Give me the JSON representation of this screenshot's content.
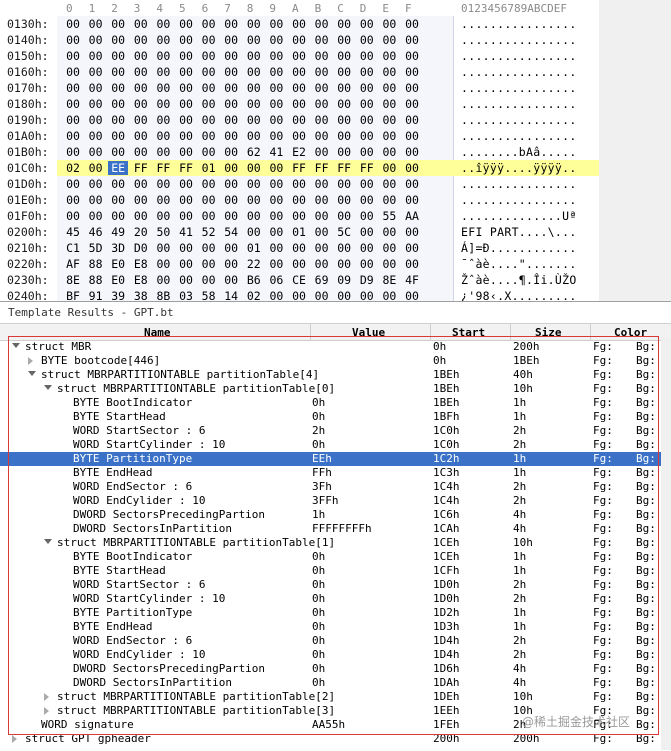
{
  "hex": {
    "column_headers": [
      "0",
      "1",
      "2",
      "3",
      "4",
      "5",
      "6",
      "7",
      "8",
      "9",
      "A",
      "B",
      "C",
      "D",
      "E",
      "F"
    ],
    "ascii_header": "0123456789ABCDEF",
    "rows": [
      {
        "offset": "0130h:",
        "bytes": [
          "00",
          "00",
          "00",
          "00",
          "00",
          "00",
          "00",
          "00",
          "00",
          "00",
          "00",
          "00",
          "00",
          "00",
          "00",
          "00"
        ],
        "ascii": "................"
      },
      {
        "offset": "0140h:",
        "bytes": [
          "00",
          "00",
          "00",
          "00",
          "00",
          "00",
          "00",
          "00",
          "00",
          "00",
          "00",
          "00",
          "00",
          "00",
          "00",
          "00"
        ],
        "ascii": "................"
      },
      {
        "offset": "0150h:",
        "bytes": [
          "00",
          "00",
          "00",
          "00",
          "00",
          "00",
          "00",
          "00",
          "00",
          "00",
          "00",
          "00",
          "00",
          "00",
          "00",
          "00"
        ],
        "ascii": "................"
      },
      {
        "offset": "0160h:",
        "bytes": [
          "00",
          "00",
          "00",
          "00",
          "00",
          "00",
          "00",
          "00",
          "00",
          "00",
          "00",
          "00",
          "00",
          "00",
          "00",
          "00"
        ],
        "ascii": "................"
      },
      {
        "offset": "0170h:",
        "bytes": [
          "00",
          "00",
          "00",
          "00",
          "00",
          "00",
          "00",
          "00",
          "00",
          "00",
          "00",
          "00",
          "00",
          "00",
          "00",
          "00"
        ],
        "ascii": "................"
      },
      {
        "offset": "0180h:",
        "bytes": [
          "00",
          "00",
          "00",
          "00",
          "00",
          "00",
          "00",
          "00",
          "00",
          "00",
          "00",
          "00",
          "00",
          "00",
          "00",
          "00"
        ],
        "ascii": "................"
      },
      {
        "offset": "0190h:",
        "bytes": [
          "00",
          "00",
          "00",
          "00",
          "00",
          "00",
          "00",
          "00",
          "00",
          "00",
          "00",
          "00",
          "00",
          "00",
          "00",
          "00"
        ],
        "ascii": "................"
      },
      {
        "offset": "01A0h:",
        "bytes": [
          "00",
          "00",
          "00",
          "00",
          "00",
          "00",
          "00",
          "00",
          "00",
          "00",
          "00",
          "00",
          "00",
          "00",
          "00",
          "00"
        ],
        "ascii": "................"
      },
      {
        "offset": "01B0h:",
        "bytes": [
          "00",
          "00",
          "00",
          "00",
          "00",
          "00",
          "00",
          "00",
          "62",
          "41",
          "E2",
          "00",
          "00",
          "00",
          "00",
          "00"
        ],
        "ascii": "........bAâ....."
      },
      {
        "offset": "01C0h:",
        "bytes": [
          "02",
          "00",
          "EE",
          "FF",
          "FF",
          "FF",
          "01",
          "00",
          "00",
          "00",
          "FF",
          "FF",
          "FF",
          "FF",
          "00",
          "00"
        ],
        "ascii": "..îÿÿÿ....ÿÿÿÿ..",
        "highlight": true,
        "selected_index": 2
      },
      {
        "offset": "01D0h:",
        "bytes": [
          "00",
          "00",
          "00",
          "00",
          "00",
          "00",
          "00",
          "00",
          "00",
          "00",
          "00",
          "00",
          "00",
          "00",
          "00",
          "00"
        ],
        "ascii": "................"
      },
      {
        "offset": "01E0h:",
        "bytes": [
          "00",
          "00",
          "00",
          "00",
          "00",
          "00",
          "00",
          "00",
          "00",
          "00",
          "00",
          "00",
          "00",
          "00",
          "00",
          "00"
        ],
        "ascii": "................"
      },
      {
        "offset": "01F0h:",
        "bytes": [
          "00",
          "00",
          "00",
          "00",
          "00",
          "00",
          "00",
          "00",
          "00",
          "00",
          "00",
          "00",
          "00",
          "00",
          "55",
          "AA"
        ],
        "ascii": "..............Uª"
      },
      {
        "offset": "0200h:",
        "bytes": [
          "45",
          "46",
          "49",
          "20",
          "50",
          "41",
          "52",
          "54",
          "00",
          "00",
          "01",
          "00",
          "5C",
          "00",
          "00",
          "00"
        ],
        "ascii": "EFI PART....\\..."
      },
      {
        "offset": "0210h:",
        "bytes": [
          "C1",
          "5D",
          "3D",
          "D0",
          "00",
          "00",
          "00",
          "00",
          "01",
          "00",
          "00",
          "00",
          "00",
          "00",
          "00",
          "00"
        ],
        "ascii": "Á]=Ð............"
      },
      {
        "offset": "0220h:",
        "bytes": [
          "AF",
          "88",
          "E0",
          "E8",
          "00",
          "00",
          "00",
          "00",
          "22",
          "00",
          "00",
          "00",
          "00",
          "00",
          "00",
          "00"
        ],
        "ascii": "¯ˆàè....\"......."
      },
      {
        "offset": "0230h:",
        "bytes": [
          "8E",
          "88",
          "E0",
          "E8",
          "00",
          "00",
          "00",
          "00",
          "B6",
          "06",
          "CE",
          "69",
          "09",
          "D9",
          "8E",
          "4F"
        ],
        "ascii": "Žˆàè....¶.Îi.ÙŽO"
      },
      {
        "offset": "0240h:",
        "bytes": [
          "BF",
          "91",
          "39",
          "38",
          "8B",
          "03",
          "58",
          "14",
          "02",
          "00",
          "00",
          "00",
          "00",
          "00",
          "00",
          "00"
        ],
        "ascii": "¿'98‹.X........."
      }
    ]
  },
  "template": {
    "title": "Template Results - GPT.bt",
    "columns": {
      "name": "Name",
      "value": "Value",
      "start": "Start",
      "size": "Size",
      "color": "Color"
    },
    "rows": [
      {
        "level": 0,
        "expand": "down",
        "name": "struct MBR",
        "value": "",
        "start": "0h",
        "size": "200h",
        "fg": "Fg:",
        "bg": "Bg:"
      },
      {
        "level": 1,
        "expand": "right",
        "name": "BYTE bootcode[446]",
        "value": "",
        "start": "0h",
        "size": "1BEh",
        "fg": "Fg:",
        "bg": "Bg:"
      },
      {
        "level": 1,
        "expand": "down",
        "name": "struct MBRPARTITIONTABLE partitionTable[4]",
        "value": "",
        "start": "1BEh",
        "size": "40h",
        "fg": "Fg:",
        "bg": "Bg:"
      },
      {
        "level": 2,
        "expand": "down",
        "name": "struct MBRPARTITIONTABLE partitionTable[0]",
        "value": "",
        "start": "1BEh",
        "size": "10h",
        "fg": "Fg:",
        "bg": "Bg:"
      },
      {
        "level": 3,
        "name": "BYTE BootIndicator",
        "value": "0h",
        "start": "1BEh",
        "size": "1h",
        "fg": "Fg:",
        "bg": "Bg:"
      },
      {
        "level": 3,
        "name": "BYTE StartHead",
        "value": "0h",
        "start": "1BFh",
        "size": "1h",
        "fg": "Fg:",
        "bg": "Bg:"
      },
      {
        "level": 3,
        "name": "WORD StartSector : 6",
        "value": "2h",
        "start": "1C0h",
        "size": "2h",
        "fg": "Fg:",
        "bg": "Bg:"
      },
      {
        "level": 3,
        "name": "WORD StartCylinder : 10",
        "value": "0h",
        "start": "1C0h",
        "size": "2h",
        "fg": "Fg:",
        "bg": "Bg:"
      },
      {
        "level": 3,
        "name": "BYTE PartitionType",
        "value": "EEh",
        "start": "1C2h",
        "size": "1h",
        "fg": "Fg:",
        "bg": "Bg:",
        "selected": true
      },
      {
        "level": 3,
        "name": "BYTE EndHead",
        "value": "FFh",
        "start": "1C3h",
        "size": "1h",
        "fg": "Fg:",
        "bg": "Bg:"
      },
      {
        "level": 3,
        "name": "WORD EndSector : 6",
        "value": "3Fh",
        "start": "1C4h",
        "size": "2h",
        "fg": "Fg:",
        "bg": "Bg:"
      },
      {
        "level": 3,
        "name": "WORD EndCylider : 10",
        "value": "3FFh",
        "start": "1C4h",
        "size": "2h",
        "fg": "Fg:",
        "bg": "Bg:"
      },
      {
        "level": 3,
        "name": "DWORD SectorsPrecedingPartion",
        "value": "1h",
        "start": "1C6h",
        "size": "4h",
        "fg": "Fg:",
        "bg": "Bg:"
      },
      {
        "level": 3,
        "name": "DWORD SectorsInPartition",
        "value": "FFFFFFFFh",
        "start": "1CAh",
        "size": "4h",
        "fg": "Fg:",
        "bg": "Bg:"
      },
      {
        "level": 2,
        "expand": "down",
        "name": "struct MBRPARTITIONTABLE partitionTable[1]",
        "value": "",
        "start": "1CEh",
        "size": "10h",
        "fg": "Fg:",
        "bg": "Bg:"
      },
      {
        "level": 3,
        "name": "BYTE BootIndicator",
        "value": "0h",
        "start": "1CEh",
        "size": "1h",
        "fg": "Fg:",
        "bg": "Bg:"
      },
      {
        "level": 3,
        "name": "BYTE StartHead",
        "value": "0h",
        "start": "1CFh",
        "size": "1h",
        "fg": "Fg:",
        "bg": "Bg:"
      },
      {
        "level": 3,
        "name": "WORD StartSector : 6",
        "value": "0h",
        "start": "1D0h",
        "size": "2h",
        "fg": "Fg:",
        "bg": "Bg:"
      },
      {
        "level": 3,
        "name": "WORD StartCylinder : 10",
        "value": "0h",
        "start": "1D0h",
        "size": "2h",
        "fg": "Fg:",
        "bg": "Bg:"
      },
      {
        "level": 3,
        "name": "BYTE PartitionType",
        "value": "0h",
        "start": "1D2h",
        "size": "1h",
        "fg": "Fg:",
        "bg": "Bg:"
      },
      {
        "level": 3,
        "name": "BYTE EndHead",
        "value": "0h",
        "start": "1D3h",
        "size": "1h",
        "fg": "Fg:",
        "bg": "Bg:"
      },
      {
        "level": 3,
        "name": "WORD EndSector : 6",
        "value": "0h",
        "start": "1D4h",
        "size": "2h",
        "fg": "Fg:",
        "bg": "Bg:"
      },
      {
        "level": 3,
        "name": "WORD EndCylider : 10",
        "value": "0h",
        "start": "1D4h",
        "size": "2h",
        "fg": "Fg:",
        "bg": "Bg:"
      },
      {
        "level": 3,
        "name": "DWORD SectorsPrecedingPartion",
        "value": "0h",
        "start": "1D6h",
        "size": "4h",
        "fg": "Fg:",
        "bg": "Bg:"
      },
      {
        "level": 3,
        "name": "DWORD SectorsInPartition",
        "value": "0h",
        "start": "1DAh",
        "size": "4h",
        "fg": "Fg:",
        "bg": "Bg:"
      },
      {
        "level": 2,
        "expand": "right",
        "name": "struct MBRPARTITIONTABLE partitionTable[2]",
        "value": "",
        "start": "1DEh",
        "size": "10h",
        "fg": "Fg:",
        "bg": "Bg:"
      },
      {
        "level": 2,
        "expand": "right",
        "name": "struct MBRPARTITIONTABLE partitionTable[3]",
        "value": "",
        "start": "1EEh",
        "size": "10h",
        "fg": "Fg:",
        "bg": "Bg:"
      },
      {
        "level": 1,
        "name": "WORD signature",
        "value": "AA55h",
        "start": "1FEh",
        "size": "2h",
        "fg": "Fg:",
        "bg": "Bg:"
      },
      {
        "level": 0,
        "expand": "right",
        "name": "struct GPT gpheader",
        "value": "",
        "start": "200h",
        "size": "200h",
        "fg": "Fg:",
        "bg": "Bg:"
      }
    ]
  },
  "watermark": "@稀土掘金技术社区",
  "colors": {
    "highlight_row": "#ffff99",
    "selection": "#3b72c8",
    "red_box": "#d83a3a"
  }
}
